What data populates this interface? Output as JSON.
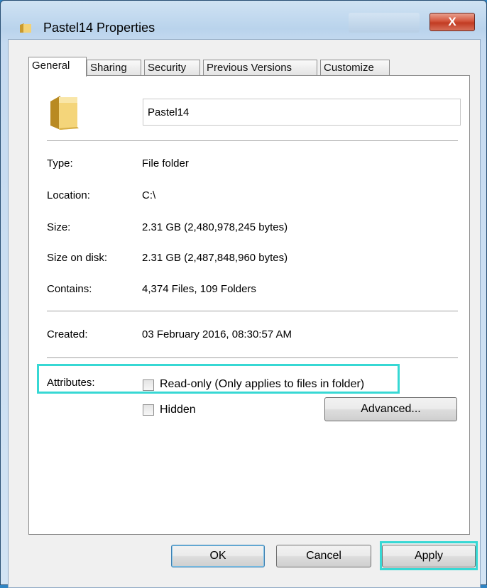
{
  "window": {
    "title": "Pastel14 Properties",
    "close_label": "X"
  },
  "tabs": [
    "General",
    "Sharing",
    "Security",
    "Previous Versions",
    "Customize"
  ],
  "general": {
    "name_value": "Pastel14",
    "type_label": "Type:",
    "type_value": "File folder",
    "location_label": "Location:",
    "location_value": "C:\\",
    "size_label": "Size:",
    "size_value": "2.31 GB (2,480,978,245 bytes)",
    "size_on_disk_label": "Size on disk:",
    "size_on_disk_value": "2.31 GB (2,487,848,960 bytes)",
    "contains_label": "Contains:",
    "contains_value": "4,374 Files, 109 Folders",
    "created_label": "Created:",
    "created_value": "03 February 2016, 08:30:57 AM",
    "attributes_label": "Attributes:",
    "readonly_label": "Read-only (Only applies to files in folder)",
    "readonly_checked": false,
    "hidden_label": "Hidden",
    "hidden_checked": false,
    "advanced_label": "Advanced..."
  },
  "footer": {
    "ok_label": "OK",
    "cancel_label": "Cancel",
    "apply_label": "Apply"
  },
  "colors": {
    "highlight": "#37d8d4",
    "close_button": "#c23b22",
    "window_frame": "#2f84c3"
  }
}
